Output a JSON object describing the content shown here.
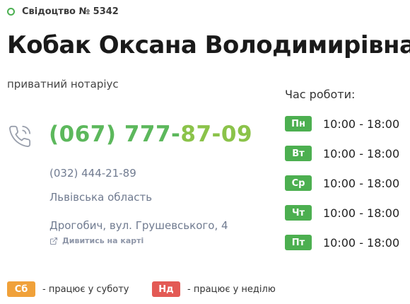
{
  "certificate": {
    "text": "Свідоцтво № 5342"
  },
  "notary": {
    "name": "Кобак Оксана Володимирівна",
    "role": "приватний нотаріус"
  },
  "contacts": {
    "phone_main_prefix": "(067) 777-",
    "phone_main_suffix": "87-09",
    "phone_alt": "(032) 444-21-89",
    "region": "Львівська область",
    "address": "Дрогобич, вул. Грушевського, 4",
    "map_link": "Дивитись на карті"
  },
  "hours": {
    "title": "Час роботи:",
    "days": [
      {
        "day": "Пн",
        "time": "10:00 - 18:00"
      },
      {
        "day": "Вт",
        "time": "10:00 - 18:00"
      },
      {
        "day": "Ср",
        "time": "10:00 - 18:00"
      },
      {
        "day": "Чт",
        "time": "10:00 - 18:00"
      },
      {
        "day": "Пт",
        "time": "10:00 - 18:00"
      }
    ]
  },
  "legend": {
    "saturday_badge": "Сб",
    "saturday_text": "- працює у суботу",
    "sunday_badge": "Нд",
    "sunday_text": "- працює у неділю"
  },
  "colors": {
    "accent_green": "#4caf50",
    "saturday_orange": "#f0a13a",
    "sunday_red": "#e35a55"
  },
  "icons": [
    "status-ring-icon",
    "phone-icon",
    "external-link-icon"
  ]
}
